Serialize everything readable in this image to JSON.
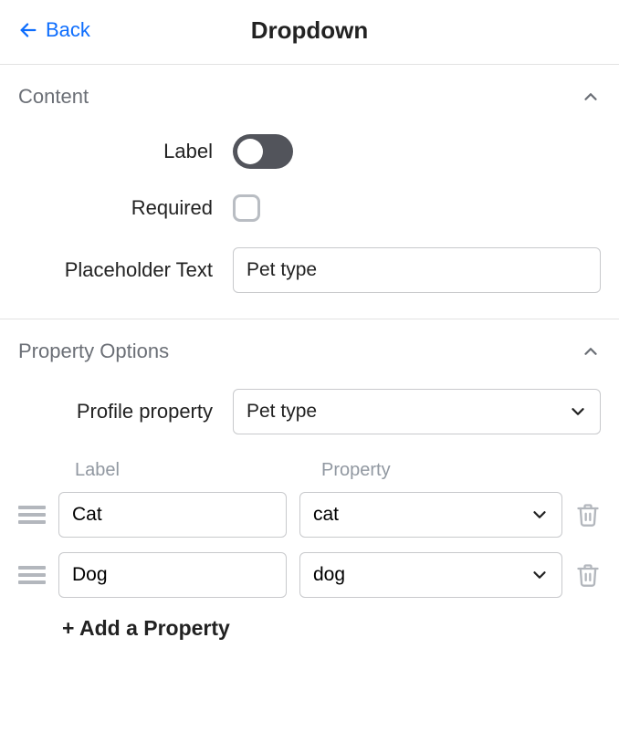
{
  "header": {
    "back": "Back",
    "title": "Dropdown"
  },
  "content": {
    "section_title": "Content",
    "label_title": "Label",
    "label_on": true,
    "required_title": "Required",
    "required_checked": false,
    "placeholder_title": "Placeholder Text",
    "placeholder_value": "Pet type"
  },
  "property_options": {
    "section_title": "Property Options",
    "profile_property_title": "Profile property",
    "profile_property_value": "Pet type",
    "col_label": "Label",
    "col_property": "Property",
    "rows": [
      {
        "label": "Cat",
        "property": "cat"
      },
      {
        "label": "Dog",
        "property": "dog"
      }
    ],
    "add_property": "+ Add a Property"
  }
}
